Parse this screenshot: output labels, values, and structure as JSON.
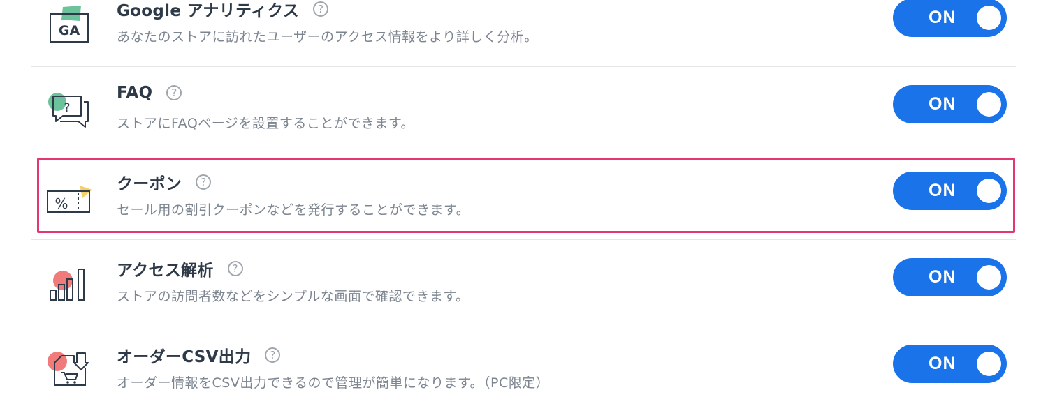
{
  "features": [
    {
      "title": "Google アナリティクス",
      "description": "あなたのストアに訪れたユーザーのアクセス情報をより詳しく分析。",
      "toggle": "ON",
      "icon": "google-analytics-icon",
      "icon_text": "GA"
    },
    {
      "title": "FAQ",
      "description": "ストアにFAQページを設置することができます。",
      "toggle": "ON",
      "icon": "faq-chat-icon",
      "icon_text": "?"
    },
    {
      "title": "クーポン",
      "description": "セール用の割引クーポンなどを発行することができます。",
      "toggle": "ON",
      "icon": "coupon-icon",
      "icon_text": "%"
    },
    {
      "title": "アクセス解析",
      "description": "ストアの訪問者数などをシンプルな画面で確認できます。",
      "toggle": "ON",
      "icon": "bar-chart-icon"
    },
    {
      "title": "オーダーCSV出力",
      "description": "オーダー情報をCSV出力できるので管理が簡単になります。（PC限定）",
      "toggle": "ON",
      "icon": "csv-download-icon"
    }
  ],
  "help_symbol": "?",
  "highlighted_item": "クーポン",
  "colors": {
    "toggle_on": "#1a73e8",
    "highlight_border": "#e4376f",
    "accent_green": "#52b788",
    "accent_yellow": "#f4c95d",
    "accent_red": "#ef6b6b"
  }
}
